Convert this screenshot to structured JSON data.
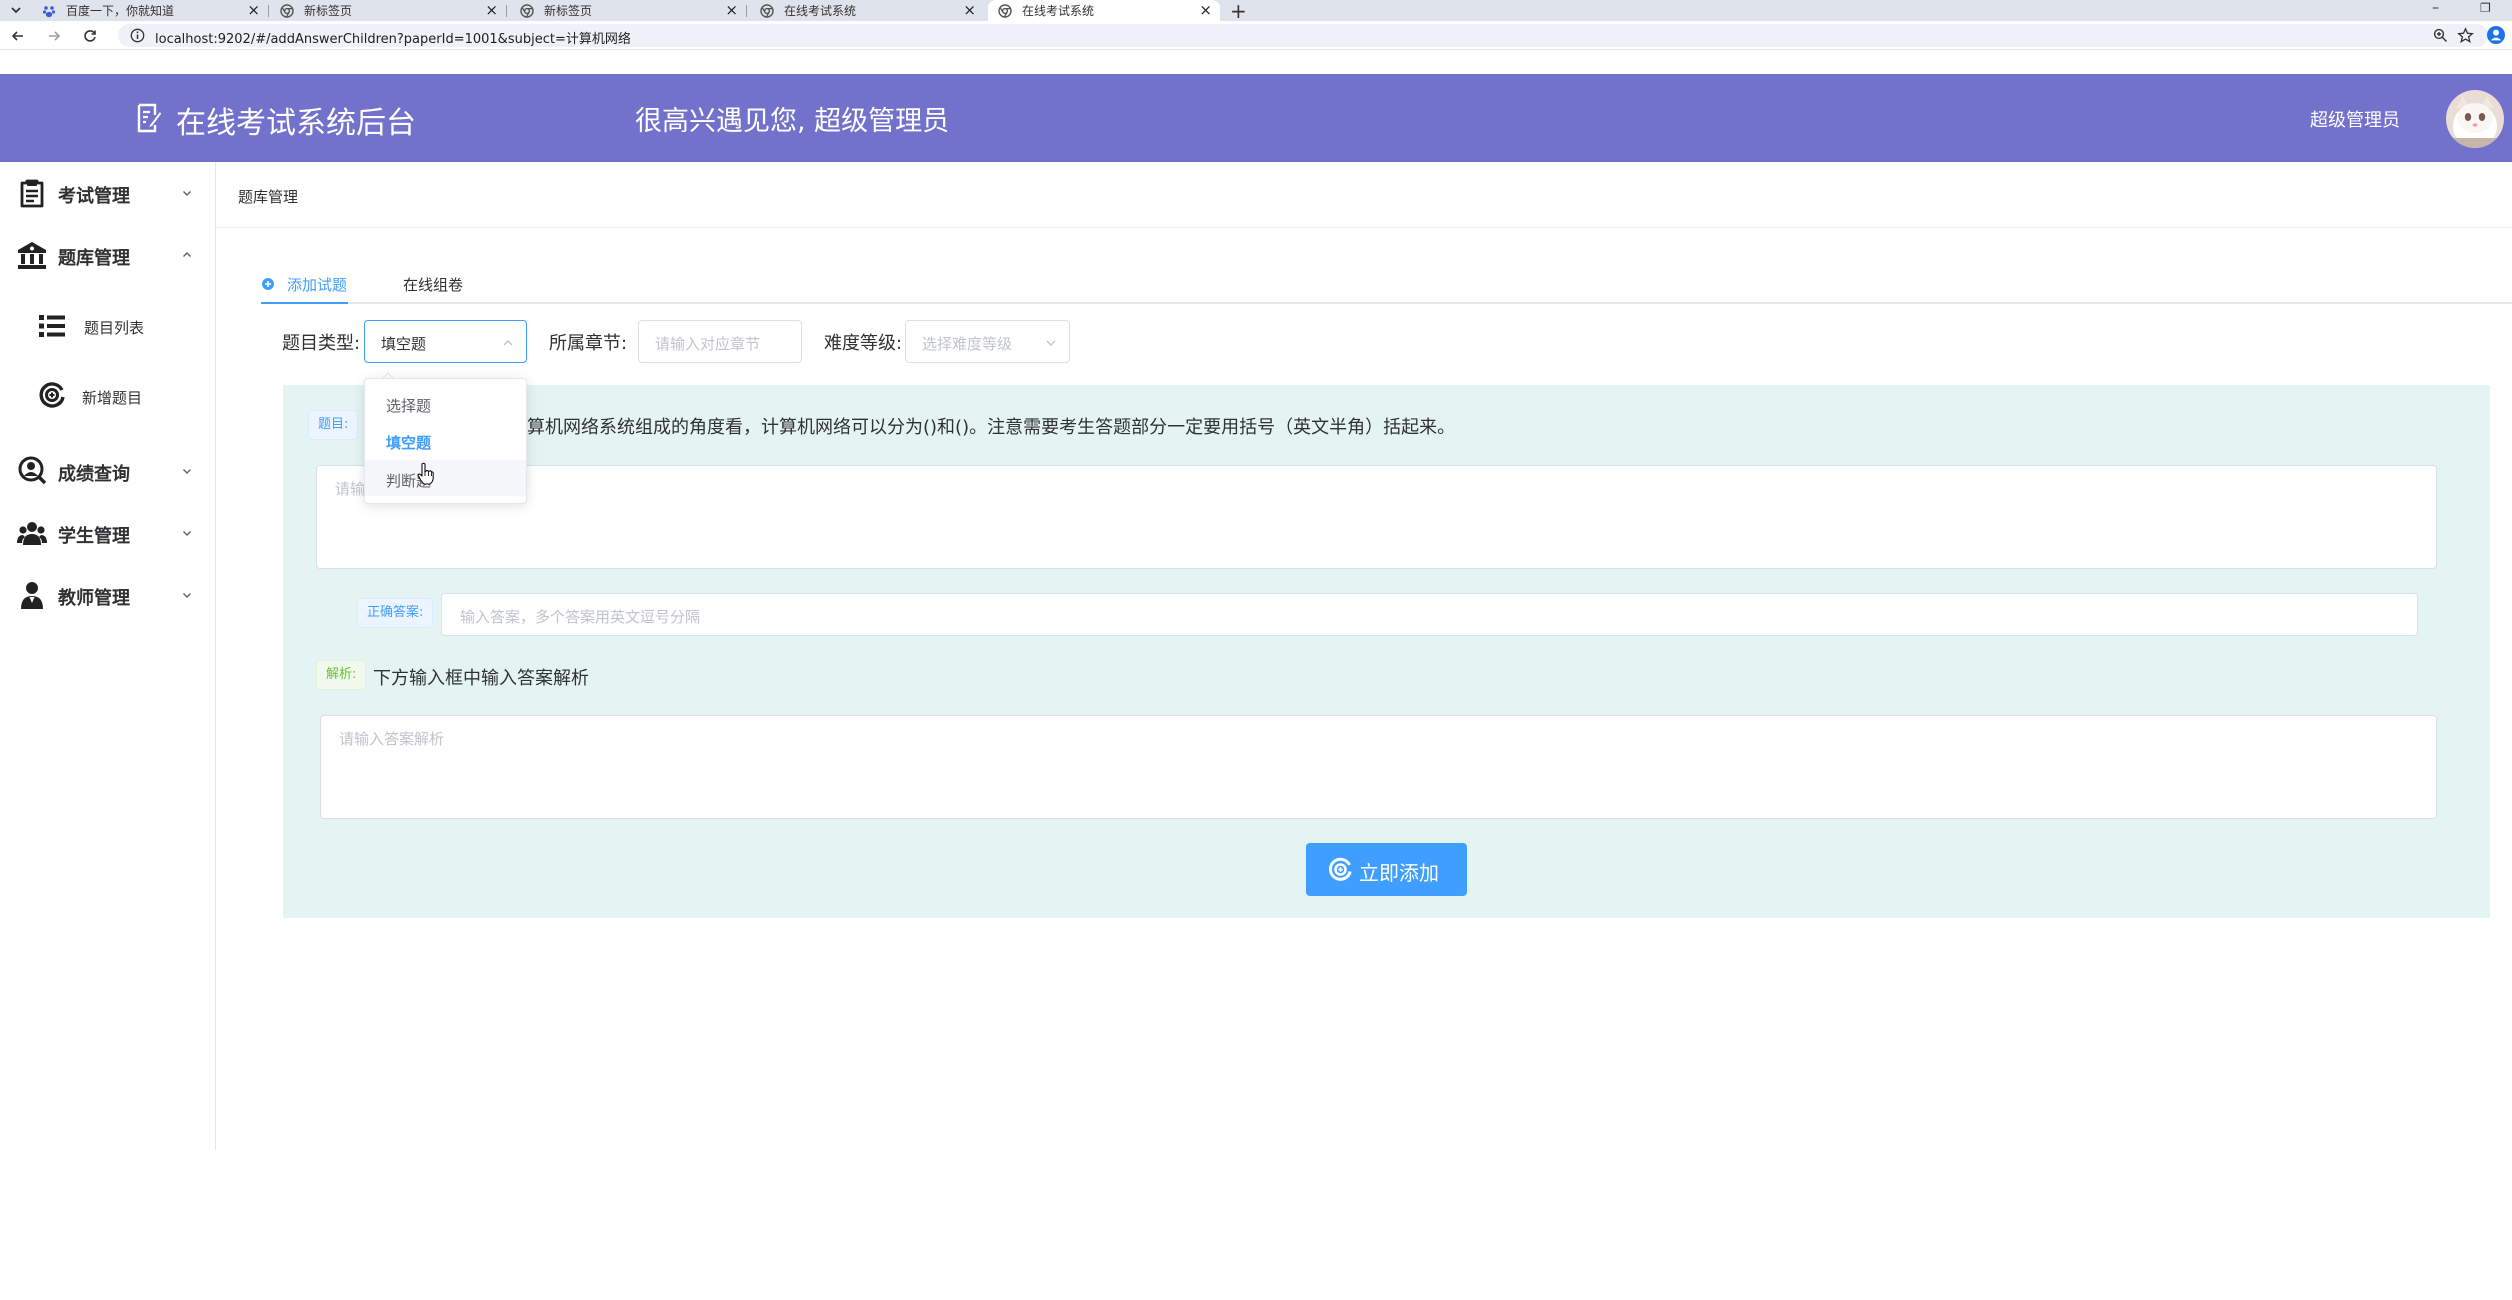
{
  "browser": {
    "tabs": [
      {
        "title": "百度一下，你就知道",
        "icon": "baidu-icon"
      },
      {
        "title": "新标签页",
        "icon": "chrome-icon"
      },
      {
        "title": "新标签页",
        "icon": "chrome-icon"
      },
      {
        "title": "在线考试系统",
        "icon": "globe-icon"
      },
      {
        "title": "在线考试系统",
        "icon": "globe-icon",
        "active": true
      }
    ],
    "new_tab": "+",
    "url": "localhost:9202/#/addAnswerChildren?paperId=1001&subject=计算机网络",
    "window_controls": {
      "minimize": "–",
      "restore": "❐"
    }
  },
  "header": {
    "title": "在线考试系统后台",
    "welcome": "很高兴遇见您, 超级管理员",
    "user_name": "超级管理员",
    "background": "#7272cc"
  },
  "sidebar": {
    "items": [
      {
        "label": "考试管理",
        "icon": "clipboard-icon",
        "expanded": false
      },
      {
        "label": "题库管理",
        "icon": "bank-icon",
        "expanded": true,
        "children": [
          {
            "label": "题目列表",
            "icon": "list-icon"
          },
          {
            "label": "新增题目",
            "icon": "add-circle-icon"
          }
        ]
      },
      {
        "label": "成绩查询",
        "icon": "search-user-icon",
        "expanded": false
      },
      {
        "label": "学生管理",
        "icon": "users-icon",
        "expanded": false
      },
      {
        "label": "教师管理",
        "icon": "teacher-icon",
        "expanded": false
      }
    ]
  },
  "breadcrumb": "题库管理",
  "tabs": [
    {
      "label": "添加试题",
      "active": true,
      "icon": "plus-circle-icon"
    },
    {
      "label": "在线组卷",
      "active": false
    }
  ],
  "form": {
    "type_label": "题目类型:",
    "type_value": "填空题",
    "chapter_label": "所属章节:",
    "chapter_placeholder": "请输入对应章节",
    "level_label": "难度等级:",
    "level_placeholder": "选择难度等级"
  },
  "dropdown": {
    "options": [
      "选择题",
      "填空题",
      "判断题"
    ],
    "selected": "填空题",
    "hovered": "判断题"
  },
  "question": {
    "tag": "题目:",
    "hint_suffix": "算机网络系统组成的角度看，计算机网络可以分为()和()。注意需要考生答题部分一定要用括号（英文半角）括起来。",
    "textarea_placeholder": "请输"
  },
  "answer": {
    "tag": "正确答案:",
    "placeholder": "输入答案，多个答案用英文逗号分隔"
  },
  "analysis": {
    "tag": "解析:",
    "hint": "下方输入框中输入答案解析",
    "placeholder": "请输入答案解析"
  },
  "submit_label": "立即添加",
  "colors": {
    "primary": "#409eff",
    "panel": "#e4f4f3",
    "header": "#7272cc"
  }
}
